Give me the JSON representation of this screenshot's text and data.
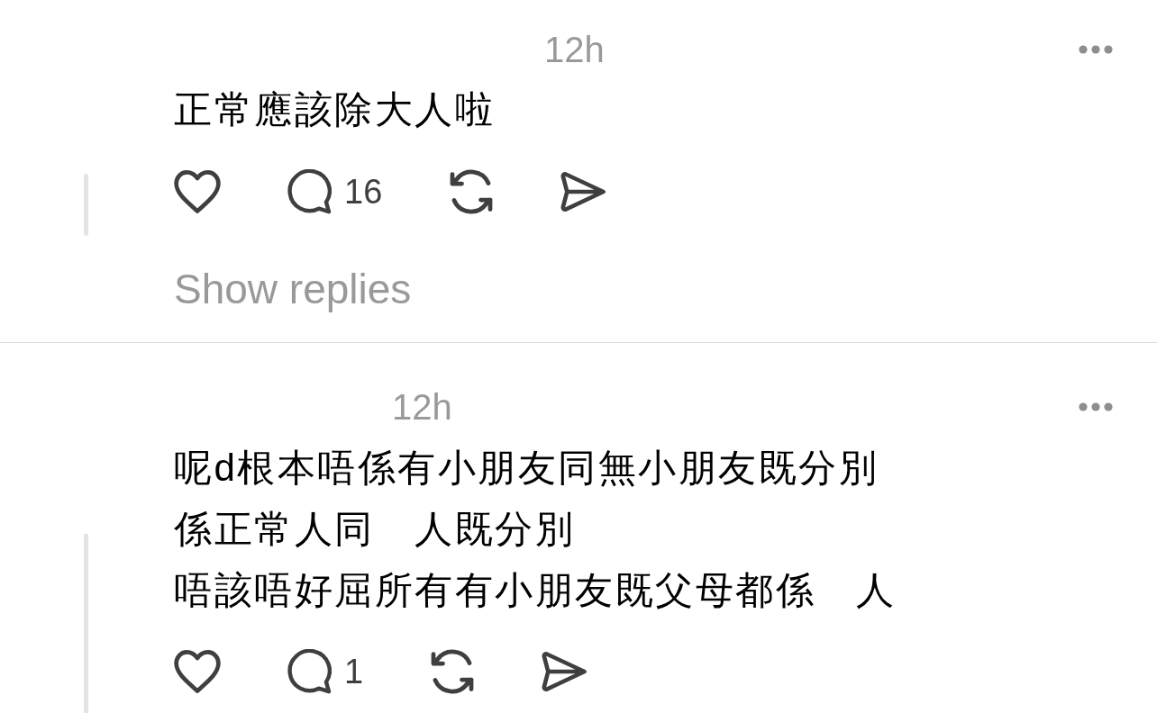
{
  "posts": [
    {
      "time": "12h",
      "lines": [
        "正常應該除大人啦"
      ],
      "comment_count": "16",
      "show_replies": "Show replies"
    },
    {
      "time": "12h",
      "lines": [
        "呢d根本唔係有小朋友同無小朋友既分別",
        "係正常人同　人既分別",
        "唔該唔好屈所有有小朋友既父母都係　人"
      ],
      "comment_count": "1"
    }
  ]
}
